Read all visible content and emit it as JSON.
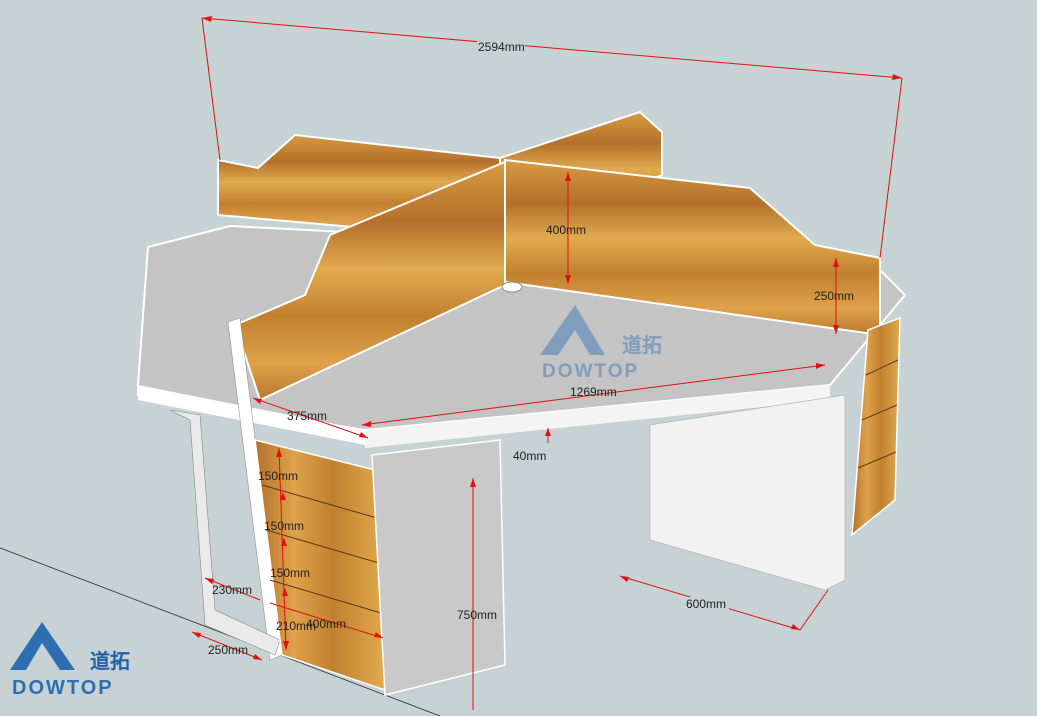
{
  "dimensions": {
    "total_width": "2594mm",
    "partition_height": "400mm",
    "partition_short": "250mm",
    "desk_depth": "1269mm",
    "drawer_offset": "375mm",
    "top_thickness": "40mm",
    "drawer_1": "150mm",
    "drawer_2": "150mm",
    "drawer_3": "150mm",
    "drawer_4": "210mm",
    "side_gap": "230mm",
    "cabinet_depth": "400mm",
    "desk_height": "750mm",
    "leg_width": "250mm",
    "leg_depth": "600mm"
  },
  "watermark": {
    "cn": "道拓",
    "en": "DOWTOP"
  },
  "logo": {
    "cn": "道拓",
    "en": "DOWTOP"
  },
  "colors": {
    "wood": "#c98c3a",
    "top": "#c4c4c4",
    "edge": "#ffffff",
    "dimension": "#e01010",
    "brand": "#2e6fb4"
  }
}
